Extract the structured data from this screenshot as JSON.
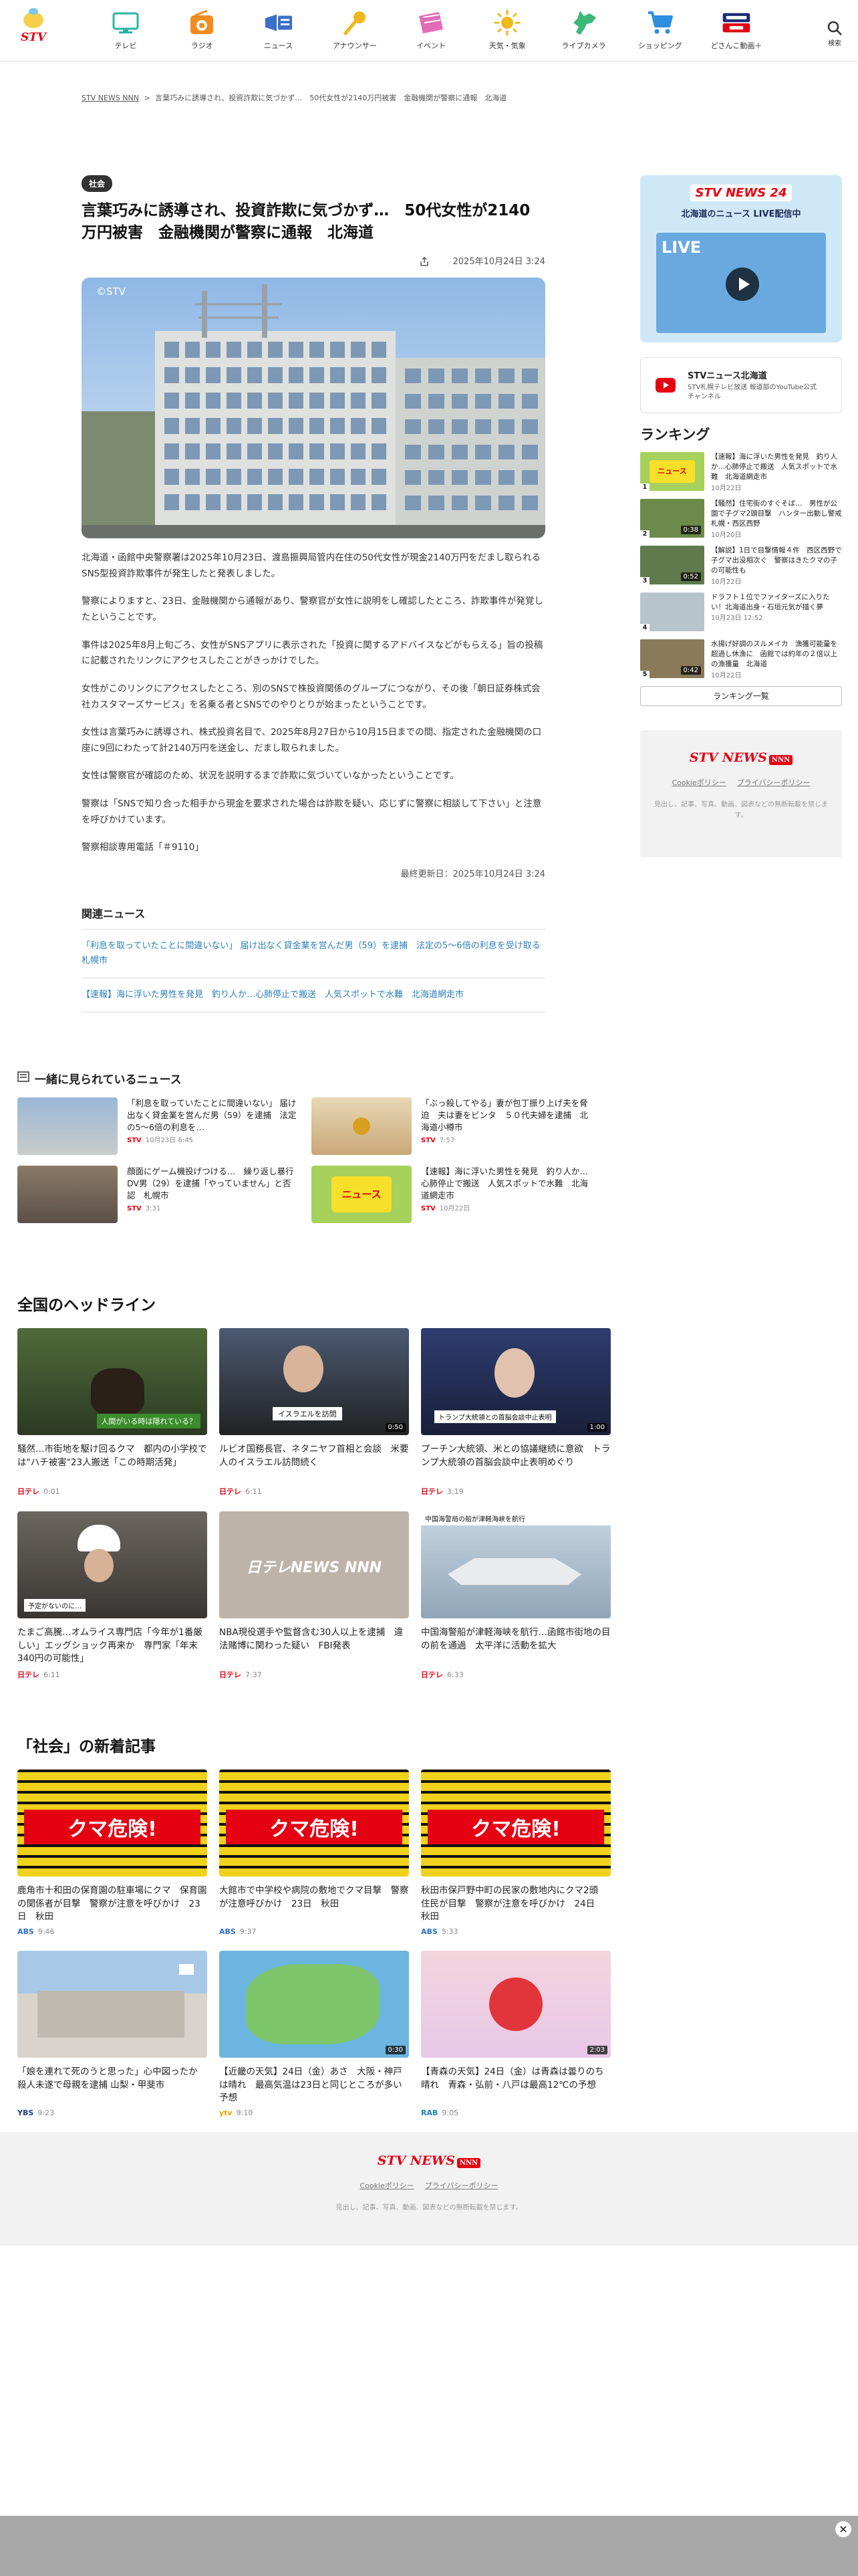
{
  "header": {
    "logo": "STV",
    "nav": [
      {
        "label": "テレビ",
        "icon": "tv-icon"
      },
      {
        "label": "ラジオ",
        "icon": "radio-icon"
      },
      {
        "label": "ニュース",
        "icon": "news-icon"
      },
      {
        "label": "アナウンサー",
        "icon": "microphone-icon"
      },
      {
        "label": "イベント",
        "icon": "ticket-icon"
      },
      {
        "label": "天気・気象",
        "icon": "weather-icon"
      },
      {
        "label": "ライブカメラ",
        "icon": "hokkaido-map-icon"
      },
      {
        "label": "ショッピング",
        "icon": "cart-icon"
      },
      {
        "label": "どさんこ動画＋",
        "icon": "dosanko-logo-icon"
      }
    ],
    "search_label": "検索"
  },
  "breadcrumb": [
    "STV NEWS NNN",
    ">",
    "言葉巧みに誘導され、投資詐欺に気づかず…　50代女性が2140万円被害　金融機関が警察に通報　北海道"
  ],
  "article": {
    "category": "社会",
    "title": "言葉巧みに誘導され、投資詐欺に気づかず…　50代女性が2140万円被害　金融機関が警察に通報　北海道",
    "date": "2025年10月24日 3:24",
    "image_credit": "©STV",
    "paragraphs": [
      "北海道・函館中央警察署は2025年10月23日、渡島振興局管内在住の50代女性が現金2140万円をだまし取られるSNS型投資詐欺事件が発生したと発表しました。",
      "警察によりますと、23日、金融機関から通報があり、警察官が女性に説明をし確認したところ、詐欺事件が発覚したということです。",
      "事件は2025年8月上旬ごろ、女性がSNSアプリに表示された「投資に関するアドバイスなどがもらえる」旨の投稿に記載されたリンクにアクセスしたことがきっかけでした。",
      "女性がこのリンクにアクセスしたところ、別のSNSで株投資関係のグループにつながり、その後「朝日証券株式会社カスタマーズサービス」を名乗る者とSNSでのやりとりが始まったということです。",
      "女性は言葉巧みに誘導され、株式投資名目で、2025年8月27日から10月15日までの間、指定された金融機関の口座に9回にわたって計2140万円を送金し、だまし取られました。",
      "女性は警察官が確認のため、状況を説明するまで詐欺に気づいていなかったということです。",
      "警察は「SNSで知り合った相手から現金を要求された場合は詐欺を疑い、応じずに警察に相談して下さい」と注意を呼びかけています。",
      "警察相談専用電話「＃9110」"
    ],
    "updated": "最終更新日：2025年10月24日 3:24"
  },
  "related": {
    "title": "関連ニュース",
    "items": [
      "「利息を取っていたことに間違いない」 届け出なく貸金業を営んだ男（59）を逮捕　法定の5〜6倍の利息を受け取る　札幌市",
      "【速報】海に浮いた男性を発見　釣り人か…心肺停止で搬送　人気スポットで水難　北海道網走市"
    ]
  },
  "sidebar": {
    "live_logo": "STV NEWS 24",
    "live_text": "北海道のニュース LIVE配信中",
    "live_badge": "LIVE",
    "youtube_title": "STVニュース北海道",
    "youtube_desc": "STV札幌テレビ放送 報道部のYouTube公式チャンネル",
    "ranking_title": "ランキング",
    "ranking": [
      {
        "rank": "1",
        "title": "【速報】海に浮いた男性を発見　釣り人か…心肺停止で搬送　人気スポットで水難　北海道網走市",
        "date": "10月22日"
      },
      {
        "rank": "2",
        "title": "【騒然】住宅街のすぐそば…　男性が公園で子グマ2頭目撃　ハンター出動し警戒　札幌・西区西野",
        "date": "10月20日"
      },
      {
        "rank": "3",
        "title": "【解説】1日で目撃情報４件　西区西野で子グマ出没相次ぐ　警察はきたクマの子の可能性も",
        "date": "10月22日"
      },
      {
        "rank": "4",
        "title": "ドラフト１位でファイターズに入りたい！北海道出身・石垣元気が描く夢",
        "date": "10月23日 12:52"
      },
      {
        "rank": "5",
        "title": "水揚げ好調のスルメイカ　漁獲可能量を超過し休漁に　函館では約年の２倍以上の漁獲量　北海道",
        "date": "10月22日"
      }
    ],
    "ranking_more": "ランキング一覧"
  },
  "viewed": {
    "title": "一緒に見られているニュース",
    "items": [
      {
        "title": "「利息を取っていたことに間違いない」 届け出なく貸金業を営んだ男（59）を逮捕　法定の5〜6倍の利息を…",
        "src": "STV",
        "date": "10月23日 6:45"
      },
      {
        "title": "「ぶっ殺してやる」妻が包丁振り上げ夫を脅迫　夫は妻をビンタ　５０代夫婦を逮捕　北海道小樽市",
        "src": "STV",
        "date": "7:57"
      },
      {
        "title": "顔面にゲーム機投げつける…　繰り返し暴行 DV男（29）を逮捕「やっていません」と否認　札幌市",
        "src": "STV",
        "date": "3:31"
      },
      {
        "title": "【速報】海に浮いた男性を発見　釣り人か…心肺停止で搬送　人気スポットで水難　北海道網走市",
        "src": "STV",
        "date": "10月22日"
      }
    ]
  },
  "national": {
    "title": "全国のヘッドライン",
    "items": [
      {
        "title": "騒然…市街地を駆け回るクマ　都内の小学校では\"ハチ被害\"23人搬送「この時期活発」",
        "src": "日テレ",
        "date": "0:01",
        "dur": ""
      },
      {
        "title": "ルビオ国務長官、ネタニヤフ首相と会談　米要人のイスラエル訪問続く",
        "src": "日テレ",
        "date": "6:11",
        "dur": "0:50"
      },
      {
        "title": "プーチン大統領、米との協議継続に意欲　トランプ大統領の首脳会談中止表明めぐり",
        "src": "日テレ",
        "date": "3:19",
        "dur": "1:00"
      },
      {
        "title": "たまご高騰…オムライス専門店「今年が1番厳しい」エッグショック再来か　専門家「年末340円の可能性」",
        "src": "日テレ",
        "date": "6:11",
        "dur": ""
      },
      {
        "title": "NBA現役選手や監督含む30人以上を逮捕　違法賭博に関わった疑い　FBI発表",
        "src": "日テレ",
        "date": "7:37",
        "dur": ""
      },
      {
        "title": "中国海警船が津軽海峡を航行…函館市街地の目の前を通過　太平洋に活動を拡大",
        "src": "日テレ",
        "date": "6:33",
        "dur": ""
      }
    ],
    "thumb_text": [
      "人間がいる時は隠れている？",
      "イスラエルを訪問",
      "トランプ大統領との首脳会談中止表明",
      "予定がないのに…",
      "日テレNEWS NNN",
      "中国海警局の船が津軽海峡を航行"
    ]
  },
  "society": {
    "title": "「社会」の新着記事",
    "items": [
      {
        "title": "鹿角市十和田の保育園の駐車場にクマ　保育園の関係者が目撃　警察が注意を呼びかけ　23日　秋田",
        "src": "ABS",
        "date": "9:46",
        "dur": ""
      },
      {
        "title": "大館市で中学校や病院の敷地でクマ目撃　警察が注意呼びかけ　23日　秋田",
        "src": "ABS",
        "date": "9:37",
        "dur": ""
      },
      {
        "title": "秋田市保戸野中町の民家の敷地内にクマ2頭　住民が目撃　警察が注意を呼びかけ　24日　秋田",
        "src": "ABS",
        "date": "5:33",
        "dur": ""
      },
      {
        "title": "「娘を連れて死のうと思った」心中図ったか 殺人未遂で母親を逮捕 山梨・甲斐市",
        "src": "YBS",
        "date": "9:23",
        "dur": ""
      },
      {
        "title": "【近畿の天気】24日（金）あさ　大阪・神戸は晴れ　最高気温は23日と同じところが多い予想",
        "src": "ytv",
        "date": "9:10",
        "dur": "0:30"
      },
      {
        "title": "【青森の天気】24日（金）は青森は曇りのち晴れ　青森・弘前・八戸は最高12℃の予想",
        "src": "RAB",
        "date": "9:05",
        "dur": "2:03"
      }
    ],
    "bear_text": "クマ危険!"
  },
  "footer": {
    "logo": "STV NEWS",
    "logo_badge": "NNN",
    "cookie": "Cookieポリシー",
    "privacy": "プライバシーポリシー",
    "copyright": "見出し、記事、写真、動画、図表などの無断転載を禁じます。"
  },
  "colors": {
    "accent": "#e50012",
    "link": "#2a7fb8",
    "banner": "#a8a8a8"
  }
}
